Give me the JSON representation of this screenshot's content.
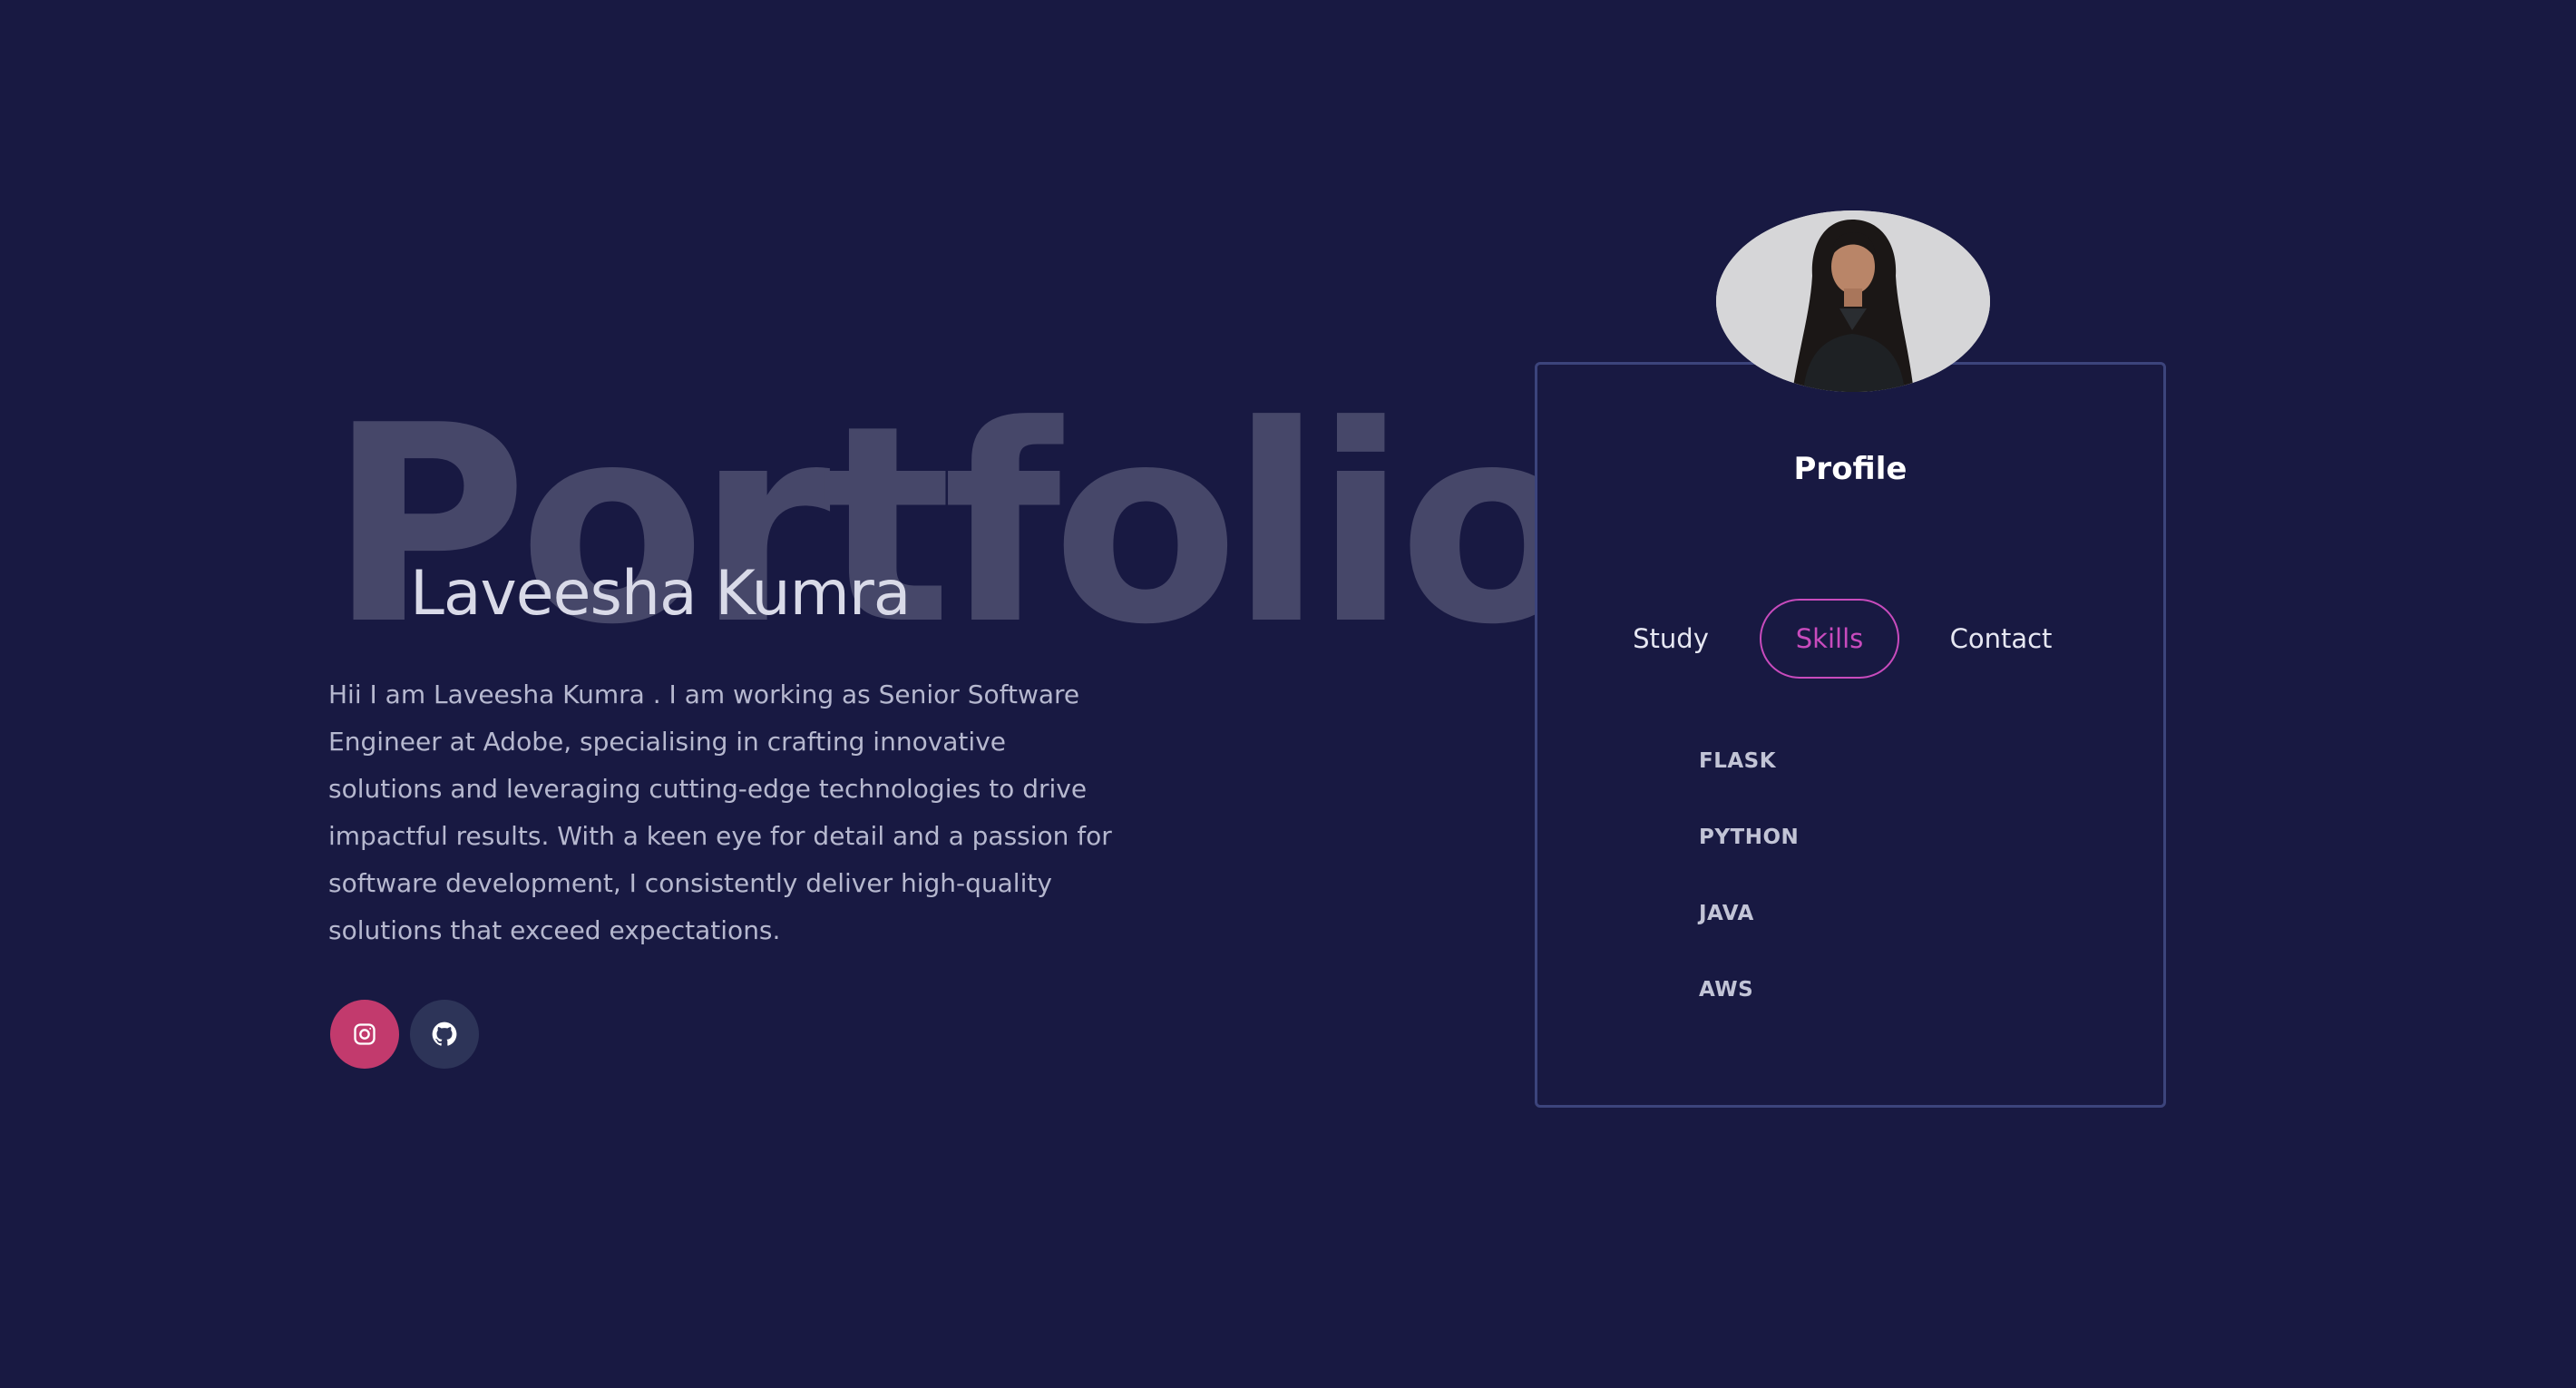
{
  "hero": {
    "watermark": "Portfolio",
    "name": "Laveesha Kumra",
    "bio": "Hii I am Laveesha Kumra . I am working as Senior Software Engineer at Adobe, specialising in crafting innovative solutions and leveraging cutting-edge technologies to drive impactful results. With a keen eye for detail and a passion for software development, I consistently deliver high-quality solutions that exceed expectations."
  },
  "socials": [
    {
      "icon": "instagram-icon",
      "color": "#c23a6d"
    },
    {
      "icon": "github-icon",
      "color": "#2d3458"
    }
  ],
  "profile": {
    "title": "Profile",
    "tabs": [
      {
        "label": "Study",
        "active": false
      },
      {
        "label": "Skills",
        "active": true
      },
      {
        "label": "Contact",
        "active": false
      }
    ],
    "skills": [
      "FLASK",
      "PYTHON",
      "JAVA",
      "AWS"
    ]
  },
  "colors": {
    "background": "#181942",
    "accent": "#c84bbd",
    "card_border": "#3c447c",
    "watermark": "#464769"
  }
}
